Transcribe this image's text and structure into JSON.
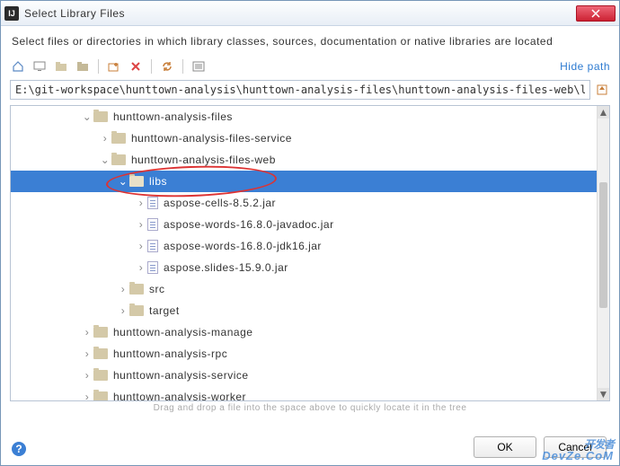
{
  "window": {
    "title": "Select Library Files"
  },
  "description": "Select files or directories in which library classes, sources, documentation or native libraries are located",
  "toolbar": {
    "hide_path": "Hide path"
  },
  "path": {
    "value": "E:\\git-workspace\\hunttown-analysis\\hunttown-analysis-files\\hunttown-analysis-files-web\\libs"
  },
  "tree": {
    "rows": [
      {
        "indent": 80,
        "arrow": "v",
        "icon": "folder",
        "label": "hunttown-analysis-files",
        "sel": false
      },
      {
        "indent": 100,
        "arrow": ">",
        "icon": "folder",
        "label": "hunttown-analysis-files-service",
        "sel": false
      },
      {
        "indent": 100,
        "arrow": "v",
        "icon": "folder",
        "label": "hunttown-analysis-files-web",
        "sel": false
      },
      {
        "indent": 120,
        "arrow": "v",
        "icon": "folder",
        "label": "libs",
        "sel": true
      },
      {
        "indent": 140,
        "arrow": ">",
        "icon": "file",
        "label": "aspose-cells-8.5.2.jar",
        "sel": false
      },
      {
        "indent": 140,
        "arrow": ">",
        "icon": "file",
        "label": "aspose-words-16.8.0-javadoc.jar",
        "sel": false
      },
      {
        "indent": 140,
        "arrow": ">",
        "icon": "file",
        "label": "aspose-words-16.8.0-jdk16.jar",
        "sel": false
      },
      {
        "indent": 140,
        "arrow": ">",
        "icon": "file",
        "label": "aspose.slides-15.9.0.jar",
        "sel": false
      },
      {
        "indent": 120,
        "arrow": ">",
        "icon": "folder",
        "label": "src",
        "sel": false
      },
      {
        "indent": 120,
        "arrow": ">",
        "icon": "folder",
        "label": "target",
        "sel": false
      },
      {
        "indent": 80,
        "arrow": ">",
        "icon": "folder",
        "label": "hunttown-analysis-manage",
        "sel": false
      },
      {
        "indent": 80,
        "arrow": ">",
        "icon": "folder",
        "label": "hunttown-analysis-rpc",
        "sel": false
      },
      {
        "indent": 80,
        "arrow": ">",
        "icon": "folder",
        "label": "hunttown-analysis-service",
        "sel": false
      },
      {
        "indent": 80,
        "arrow": ">",
        "icon": "folder",
        "label": "hunttown-analysis-worker",
        "sel": false
      }
    ]
  },
  "hint": "Drag and drop a file into the space above to quickly locate it in the tree",
  "buttons": {
    "ok": "OK",
    "cancel": "Cancel"
  },
  "watermark": {
    "main": "开发者",
    "sub": "DevZe.CoM"
  }
}
